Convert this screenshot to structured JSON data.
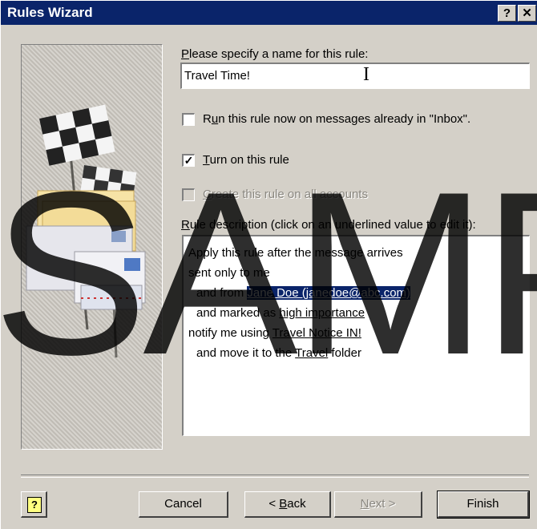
{
  "window": {
    "title": "Rules Wizard",
    "help_glyph": "?",
    "close_glyph": "✕"
  },
  "name_section": {
    "label_prefix": "",
    "label_mnemonic": "P",
    "label_rest": "lease specify a name for this rule:",
    "value": "Travel Time!"
  },
  "options": {
    "run_now": {
      "prefix": "R",
      "mnemonic": "u",
      "rest": "n this rule now on messages already in \"Inbox\".",
      "checked": false
    },
    "turn_on": {
      "prefix": "",
      "mnemonic": "T",
      "rest": "urn on this rule",
      "checked": true
    },
    "all_accounts": {
      "prefix": "",
      "mnemonic": "C",
      "rest": "reate this rule on all accounts",
      "checked": false,
      "disabled": true
    }
  },
  "description": {
    "label_prefix": "",
    "label_mnemonic": "R",
    "label_rest": "ule description (click on an underlined value to edit it):",
    "line1": "Apply this rule after the message arrives",
    "line2": "sent only to me",
    "line3_pre": "and from ",
    "line3_link": "Jane Doe (janedoe@abc.com)",
    "line4_pre": "and marked as ",
    "line4_link": "high importance",
    "line5_pre": "notify me using ",
    "line5_link": "Travel Notice IN!",
    "line6_pre": "and move it to the ",
    "line6_link": "Travel",
    "line6_post": " folder"
  },
  "buttons": {
    "help_icon": "?",
    "cancel": "Cancel",
    "back_pre": "< ",
    "back_mnemonic": "B",
    "back_rest": "ack",
    "next_pre": "",
    "next_mnemonic": "N",
    "next_rest": "ext >",
    "finish": "Finish"
  },
  "watermark": "SAMPLE",
  "colors": {
    "titlebar": "#0a246a",
    "face": "#d4d0c8",
    "selection": "#0a246a"
  }
}
